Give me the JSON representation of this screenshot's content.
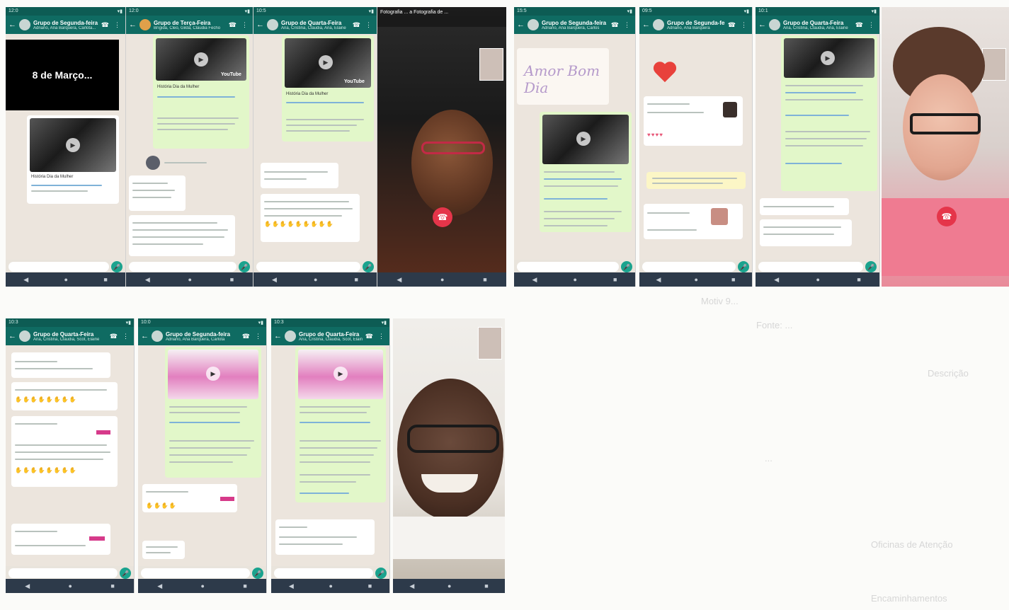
{
  "document": {
    "line_figure": "Motiv 9...",
    "line_source": "Fonte: ...",
    "line_heading1": "Descrição",
    "line_body": "...",
    "line_heading2": "Oficinas de Atenção",
    "line_heading3": "Encaminhamentos"
  },
  "phones": {
    "p1": {
      "time": "12:0",
      "title": "Grupo de Segunda-feira",
      "subtitle": "Adriano, Ana Barquera, Carlota...",
      "banner": "8 de Março...",
      "caption": "História Dia da Mulher"
    },
    "p2": {
      "time": "12:0",
      "title": "Grupo de Terça-Feira",
      "subtitle": "Brígida, Cleo, Gilda, Cláudia Fecho",
      "caption": "História Dia da Mulher",
      "yt": "YouTube"
    },
    "p3": {
      "time": "10:5",
      "title": "Grupo de Quarta-Feira",
      "subtitle": "Ana, Cristina, Cláudia, Ana, Elaine",
      "caption": "História Dia da Mulher",
      "yt": "YouTube"
    },
    "p4": {
      "caller_bar": "Fotografia ... a Fotografia de ..."
    },
    "p5": {
      "time": "15:5",
      "title": "Grupo de Segunda-feira",
      "subtitle": "Adriano, Ana Barquera, Carlos",
      "script_text": "Amor Bom Dia"
    },
    "p6": {
      "time": "09:5",
      "title": "Grupo de Segunda-feira",
      "subtitle": "Adriano, Ana Barquera"
    },
    "p7": {
      "time": "10:1",
      "title": "Grupo de Quarta-Feira",
      "subtitle": "Ana, Cristina, Cláudia, Ana, Elaine"
    },
    "p8": {},
    "p9": {
      "time": "10:3",
      "title": "Grupo de Quarta-Feira",
      "subtitle": "Ana, Cristina, Cláudia, Scot, Elaine"
    },
    "p10": {
      "time": "10:0",
      "title": "Grupo de Segunda-feira",
      "subtitle": "Adriano, Ana Barquera, Carlota"
    },
    "p11": {
      "time": "10:3",
      "title": "Grupo de Quarta-Feira",
      "subtitle": "Ana, Cristina, Cláudia, Scot, Elaine"
    },
    "p12": {}
  },
  "icons": {
    "back": "←",
    "call": "☎",
    "menu": "⋮",
    "mic": "🎤",
    "play": "▶",
    "end_call": "☎",
    "nav_back": "◀",
    "nav_home": "●",
    "nav_recent": "■"
  },
  "colors": {
    "header": "#0f6b62",
    "status": "#0d5c54",
    "chat_bg": "#ece5dd",
    "outgoing_bubble": "#e2f7c9",
    "end_call": "#e5354a",
    "navbar": "#2d3a4a"
  }
}
